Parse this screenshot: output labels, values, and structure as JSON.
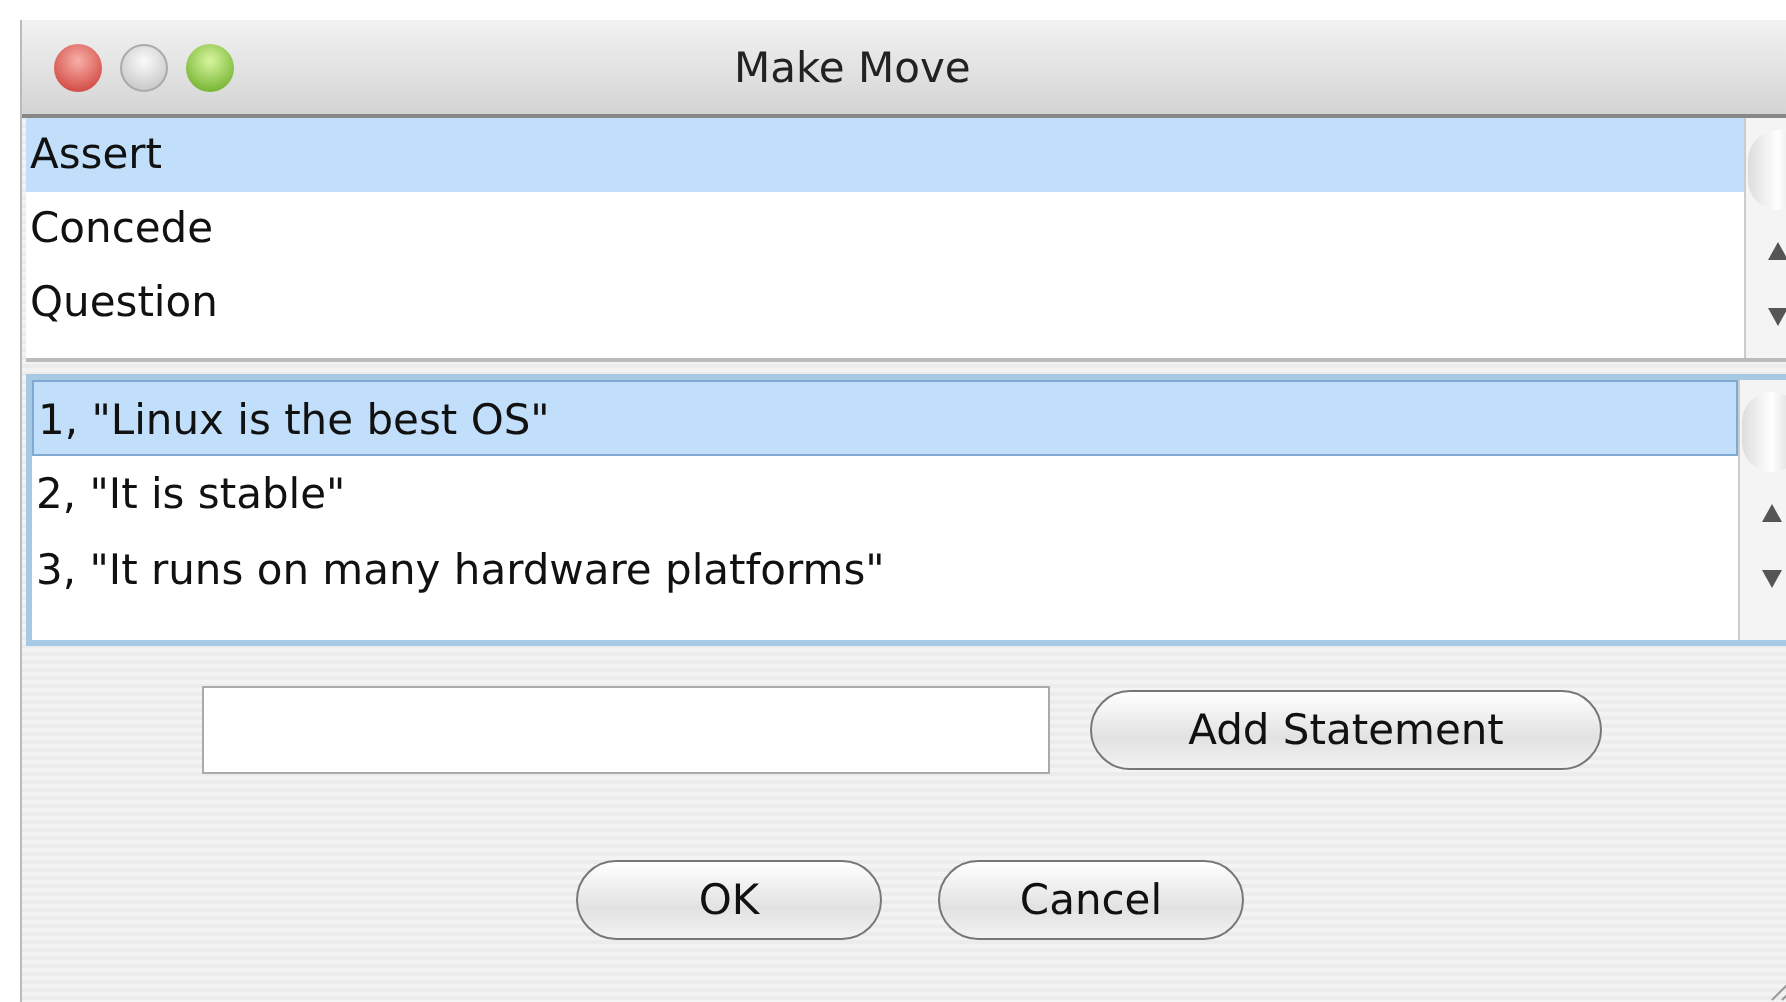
{
  "window": {
    "title": "Make Move"
  },
  "move_types": [
    {
      "label": "Assert",
      "selected": true
    },
    {
      "label": "Concede",
      "selected": false
    },
    {
      "label": "Question",
      "selected": false
    }
  ],
  "statements": [
    {
      "label": "1, \"Linux is the best OS\"",
      "selected": true
    },
    {
      "label": "2, \"It is stable\"",
      "selected": false
    },
    {
      "label": "3, \"It runs on many hardware platforms\"",
      "selected": false
    }
  ],
  "add_button": "Add Statement",
  "buttons": [
    "OK",
    "Cancel"
  ]
}
